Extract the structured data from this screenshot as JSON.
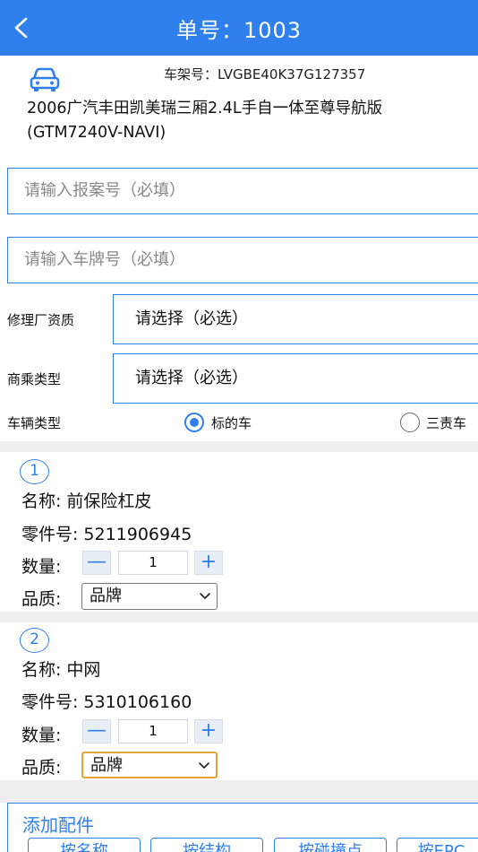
{
  "header": {
    "title": "单号：1003"
  },
  "vehicle": {
    "vin": "车架号：LVGBE40K37G127357",
    "model": "2006广汽丰田凯美瑞三厢2.4L手自一体至尊导航版(GTM7240V-NAVI)"
  },
  "form": {
    "report_placeholder": "请输入报案号（必填）",
    "plate_placeholder": "请输入车牌号（必填）",
    "repair_label": "修理厂资质",
    "repair_value": "请选择（必选）",
    "business_label": "商乘类型",
    "business_value": "请选择（必选）",
    "vehicle_type_label": "车辆类型",
    "vehicle_type_options": [
      "标的车",
      "三责车"
    ],
    "vehicle_type_selected": "标的车"
  },
  "parts": [
    {
      "index": "1",
      "name_label": "名称:",
      "name": "前保险杠皮",
      "code_label": "零件号:",
      "code": "5211906945",
      "qty_label": "数量:",
      "qty": "1",
      "quality_label": "品质:",
      "quality": "品牌"
    },
    {
      "index": "2",
      "name_label": "名称:",
      "name": "中网",
      "code_label": "零件号:",
      "code": "5310106160",
      "qty_label": "数量:",
      "qty": "1",
      "quality_label": "品质:",
      "quality": "品牌"
    }
  ],
  "stepper": {
    "minus": "—",
    "plus": "+"
  },
  "add_parts": {
    "title": "添加配件",
    "buttons": [
      "按名称",
      "按结构",
      "按碰撞点",
      "按EPC"
    ]
  },
  "colors": {
    "accent": "#2f80ed",
    "focus": "#e6a33a"
  }
}
